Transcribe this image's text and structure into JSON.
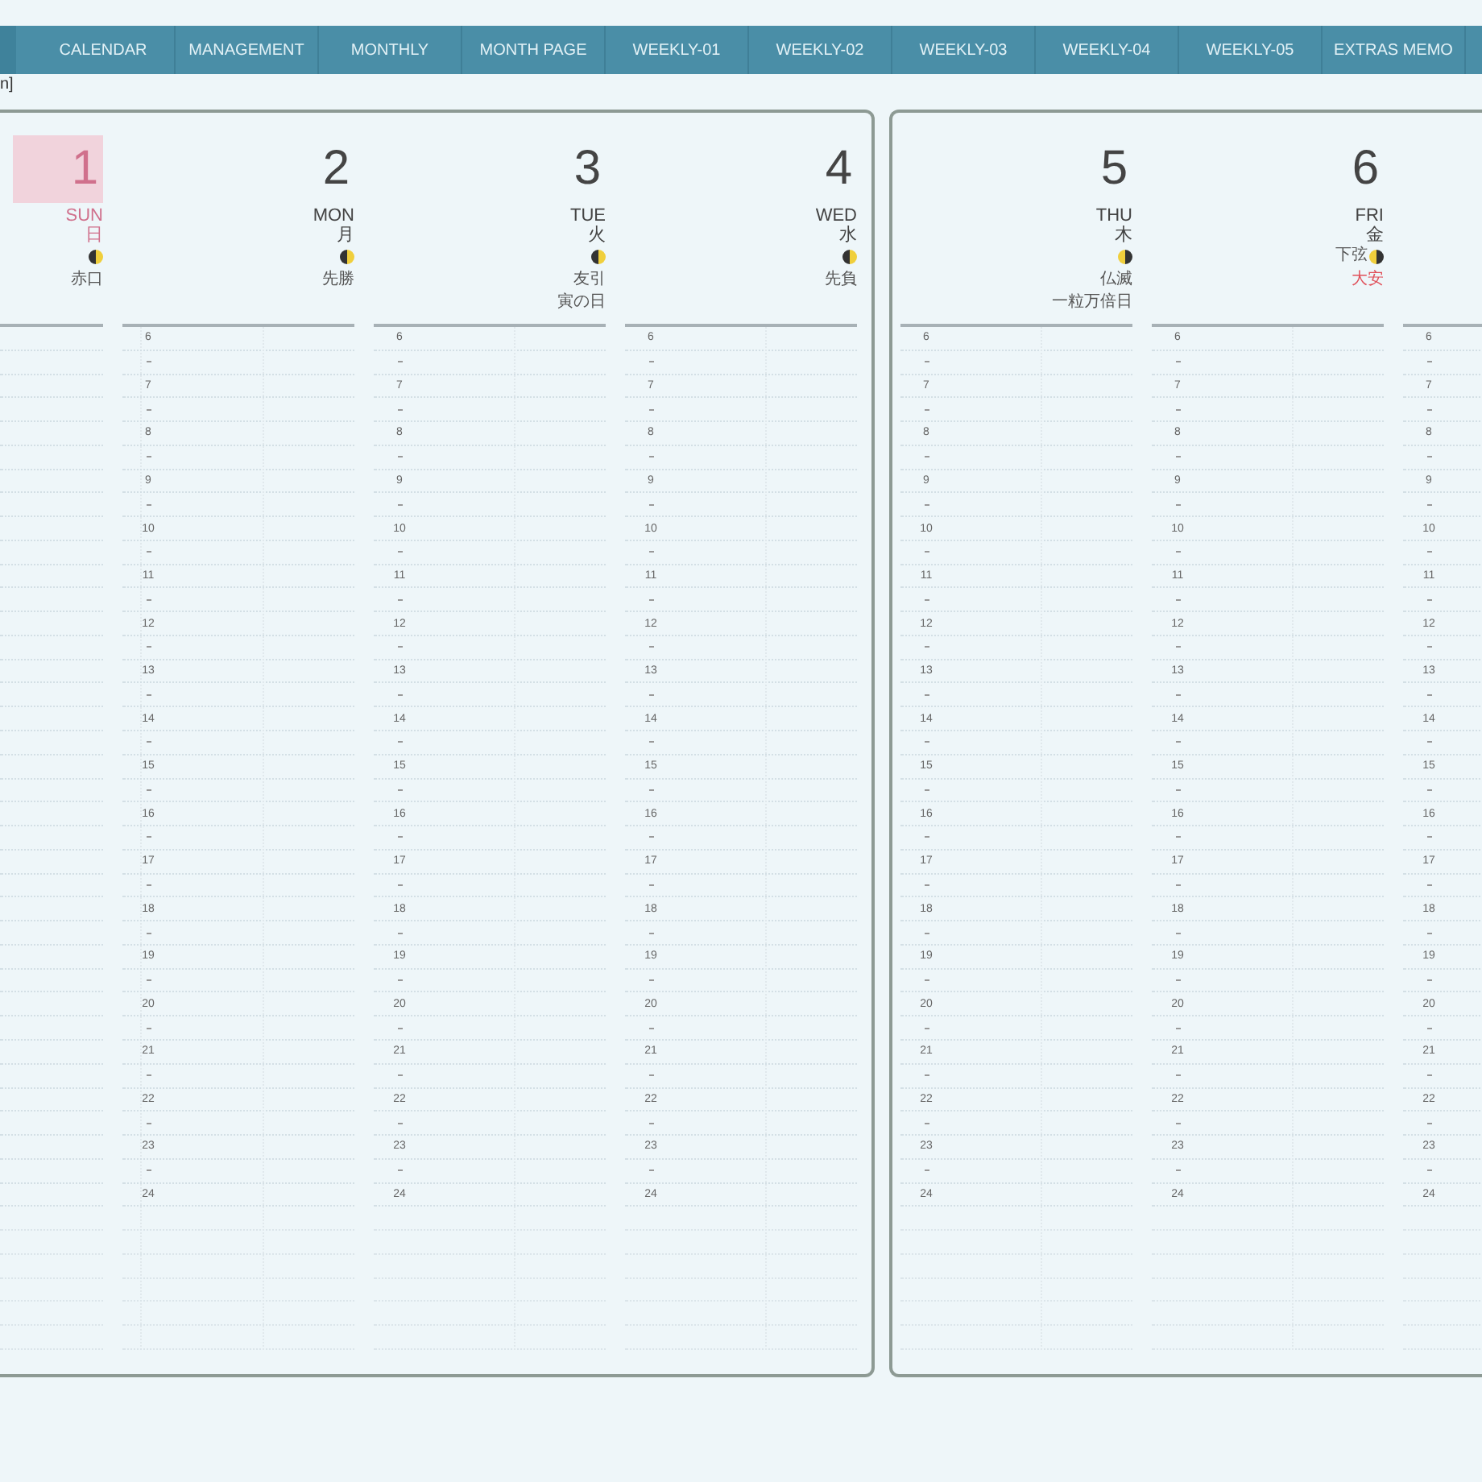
{
  "nav_tabs": [
    {
      "label": "CALENDAR",
      "selected": false
    },
    {
      "label": "MANAGEMENT",
      "selected": false
    },
    {
      "label": "MONTHLY",
      "selected": false
    },
    {
      "label": "MONTH PAGE",
      "selected": false
    },
    {
      "label": "WEEKLY-01",
      "selected": false
    },
    {
      "label": "WEEKLY-02",
      "selected": false
    },
    {
      "label": "WEEKLY-03",
      "selected": false
    },
    {
      "label": "WEEKLY-04",
      "selected": false
    },
    {
      "label": "WEEKLY-05",
      "selected": false
    },
    {
      "label": "EXTRAS MEMO",
      "selected": false
    }
  ],
  "breadcrumb": "n]",
  "pages": [
    {
      "days": [
        {
          "kind": "sunday",
          "number": "1",
          "day_en": "SUN",
          "day_ja": "日",
          "moon_waning": false,
          "rokuyo": "赤口",
          "rokuyo_emphasis": false
        },
        {
          "kind": "weekday",
          "number": "2",
          "day_en": "MON",
          "day_ja": "月",
          "moon_waning": false,
          "rokuyo": "先勝",
          "rokuyo_emphasis": false,
          "hours": [
            "6",
            "7",
            "8",
            "9",
            "10",
            "11",
            "12",
            "13",
            "14",
            "15",
            "16",
            "17",
            "18",
            "19",
            "20",
            "21",
            "22",
            "23",
            "24"
          ]
        },
        {
          "kind": "weekday",
          "number": "3",
          "day_en": "TUE",
          "day_ja": "火",
          "moon_waning": false,
          "rokuyo": "友引",
          "rokuyo_emphasis": false,
          "note": "寅の日",
          "hours": [
            "6",
            "7",
            "8",
            "9",
            "10",
            "11",
            "12",
            "13",
            "14",
            "15",
            "16",
            "17",
            "18",
            "19",
            "20",
            "21",
            "22",
            "23",
            "24"
          ]
        },
        {
          "kind": "weekday",
          "number": "4",
          "day_en": "WED",
          "day_ja": "水",
          "moon_waning": false,
          "rokuyo": "先負",
          "rokuyo_emphasis": false,
          "hours": [
            "6",
            "7",
            "8",
            "9",
            "10",
            "11",
            "12",
            "13",
            "14",
            "15",
            "16",
            "17",
            "18",
            "19",
            "20",
            "21",
            "22",
            "23",
            "24"
          ]
        }
      ]
    },
    {
      "days": [
        {
          "kind": "weekday",
          "number": "5",
          "day_en": "THU",
          "day_ja": "木",
          "moon_waning": true,
          "rokuyo": "仏滅",
          "rokuyo_emphasis": false,
          "note": "一粒万倍日",
          "hours": [
            "6",
            "7",
            "8",
            "9",
            "10",
            "11",
            "12",
            "13",
            "14",
            "15",
            "16",
            "17",
            "18",
            "19",
            "20",
            "21",
            "22",
            "23",
            "24"
          ]
        },
        {
          "kind": "weekday",
          "number": "6",
          "day_en": "FRI",
          "day_ja": "金",
          "moon_waning": true,
          "moon_label": "下弦",
          "rokuyo": "大安",
          "rokuyo_emphasis": true,
          "hours": [
            "6",
            "7",
            "8",
            "9",
            "10",
            "11",
            "12",
            "13",
            "14",
            "15",
            "16",
            "17",
            "18",
            "19",
            "20",
            "21",
            "22",
            "23",
            "24"
          ]
        },
        {
          "kind": "partial",
          "hours": [
            "6",
            "7",
            "8",
            "9",
            "10",
            "11",
            "12",
            "13",
            "14",
            "15",
            "16",
            "17",
            "18",
            "19",
            "20",
            "21",
            "22",
            "23",
            "24"
          ]
        }
      ]
    }
  ]
}
